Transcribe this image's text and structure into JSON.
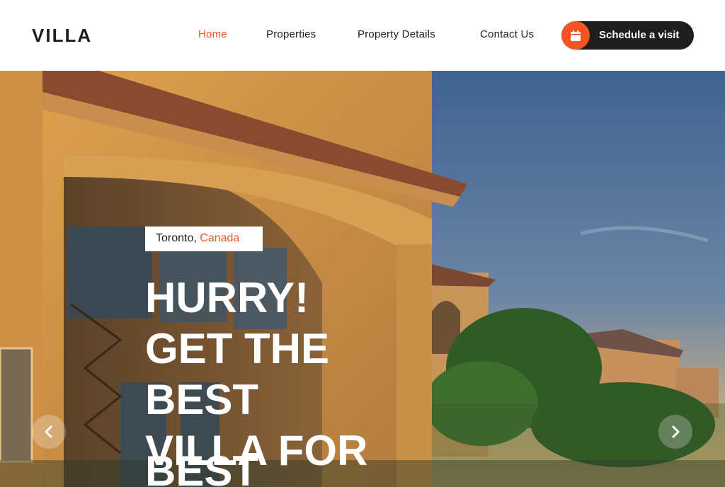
{
  "header": {
    "logo": "VILLA",
    "nav": [
      {
        "label": "Home",
        "active": true
      },
      {
        "label": "Properties",
        "active": false
      },
      {
        "label": "Property Details",
        "active": false
      },
      {
        "label": "Contact Us",
        "active": false
      }
    ],
    "cta": {
      "label": "Schedule a visit",
      "icon": "calendar-icon"
    }
  },
  "hero": {
    "location_city": "Toronto,",
    "location_country": "Canada",
    "headline": "HURRY! GET THE BEST VILLA FOR",
    "headline_next": "BEST",
    "prev_icon": "chevron-left-icon",
    "next_icon": "chevron-right-icon"
  },
  "colors": {
    "accent": "#f35525",
    "dark": "#1e1e1e"
  }
}
